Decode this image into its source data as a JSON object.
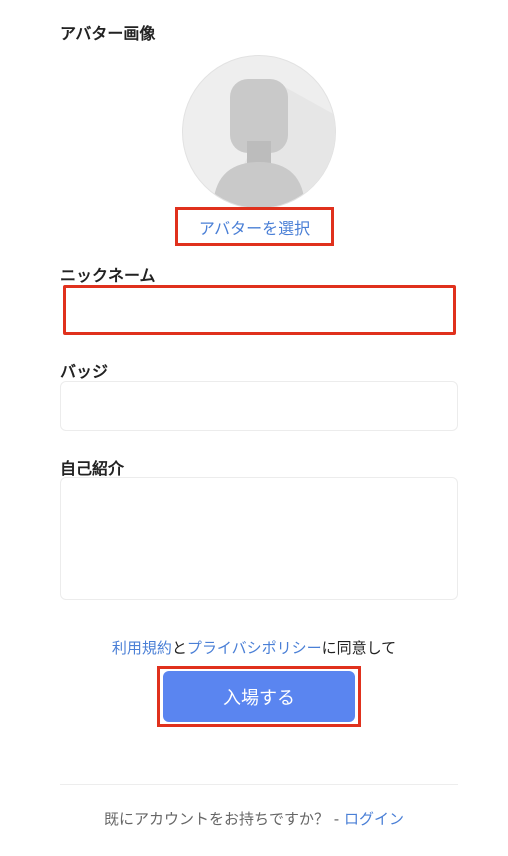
{
  "avatar": {
    "section_label": "アバター画像",
    "choose_label": "アバターを選択"
  },
  "nickname": {
    "label": "ニックネーム",
    "value": "",
    "placeholder": ""
  },
  "badge": {
    "label": "バッジ",
    "value": "",
    "placeholder": ""
  },
  "bio": {
    "label": "自己紹介",
    "value": "",
    "placeholder": ""
  },
  "terms": {
    "terms_link": "利用規約",
    "and": "と",
    "privacy_link": "プライバシポリシー",
    "agree": "に同意して"
  },
  "submit_label": "入場する",
  "footer": {
    "question": "既にアカウントをお持ちですか？ - ",
    "login_link": "ログイン"
  },
  "colors": {
    "accent": "#5a85f0",
    "link": "#4a7fd6",
    "highlight": "#e0311d"
  }
}
